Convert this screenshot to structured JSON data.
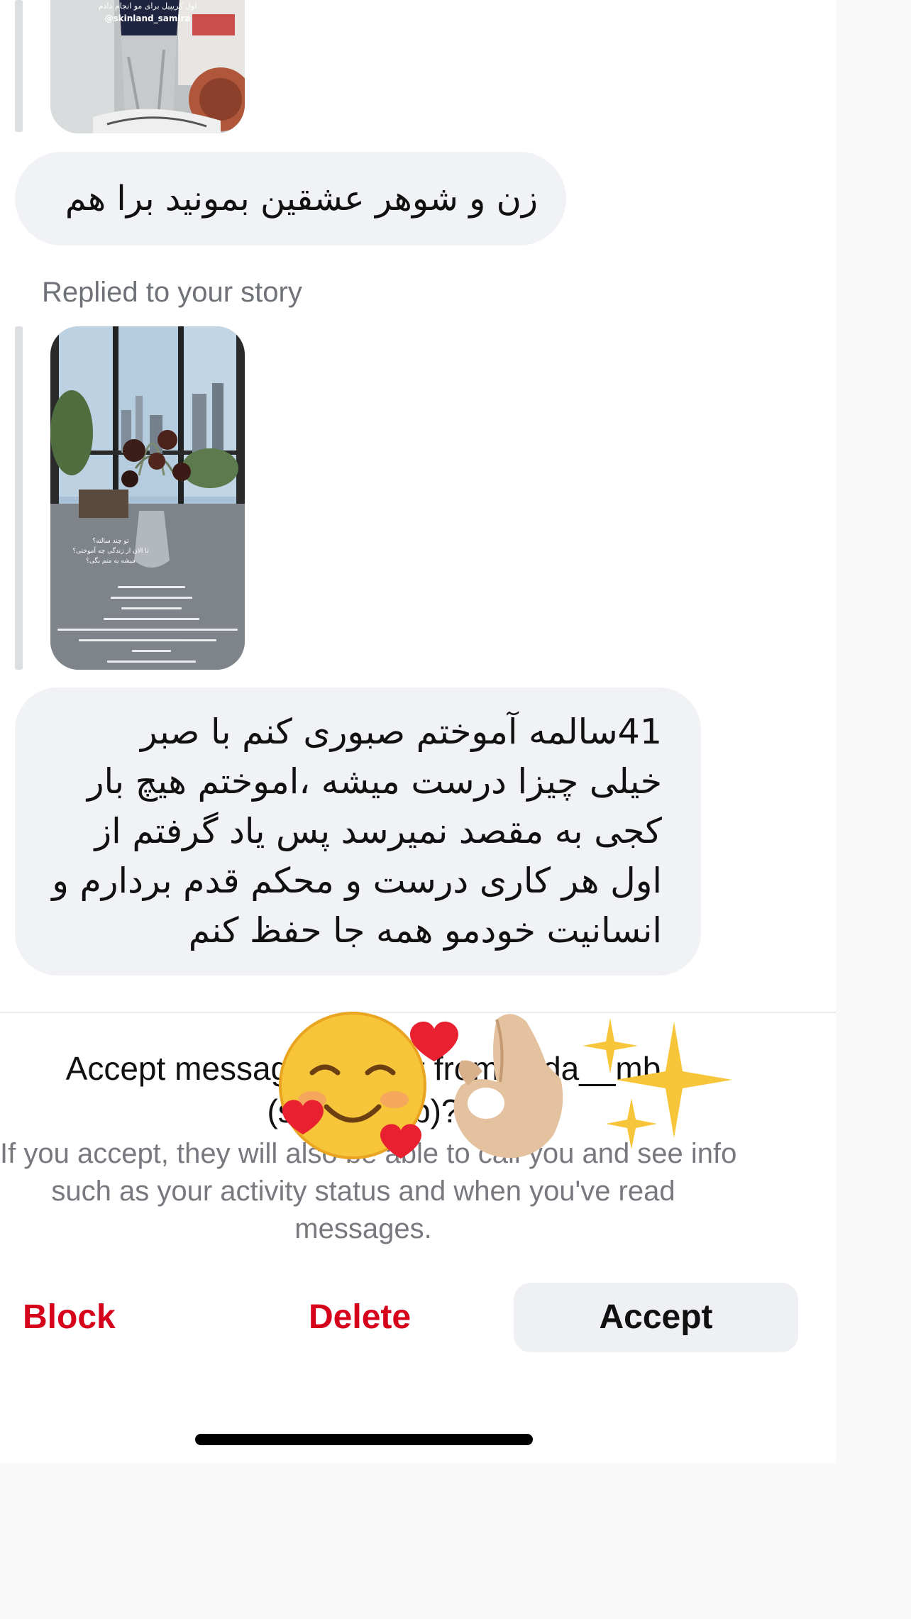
{
  "thread": {
    "story_caption_top": "اول کریپیل برای مو انجام دادم",
    "story_username": "@skinland_samira",
    "message1": "زن و شوهر عشقین بمونید برا هم",
    "replied_label": "Replied to your story",
    "story2_text_lines": [
      "تو چند سالته؟",
      "تا الان از زندگی چه آموختی؟",
      "میشه به منم بگی؟"
    ],
    "message2_lines": [
      "41سالمه آموختم صبوری کنم  با صبر",
      "خیلی چیزا درست میشه ،اموختم هیچ بار",
      "کجی به مقصد نمیرسد پس یاد گرفتم از",
      "اول هر کاری درست و محکم قدم بردارم و",
      "انسانیت خودمو همه جا حفظ کنم"
    ]
  },
  "request": {
    "title_line1": "Accept message request from seda__mb",
    "title_line2": "(seda__mb)?",
    "info_lines": [
      "If you accept, they will also be able to call you and see info",
      "such as your activity status and when you've read",
      "messages."
    ]
  },
  "actions": {
    "block": "Block",
    "delete": "Delete",
    "accept": "Accept"
  },
  "stickers": [
    "smiling-face-with-hearts",
    "ok-hand",
    "sparkles"
  ],
  "colors": {
    "danger": "#d6011b",
    "bubble": "#f1f2f5",
    "muted_text": "#6f7278"
  }
}
